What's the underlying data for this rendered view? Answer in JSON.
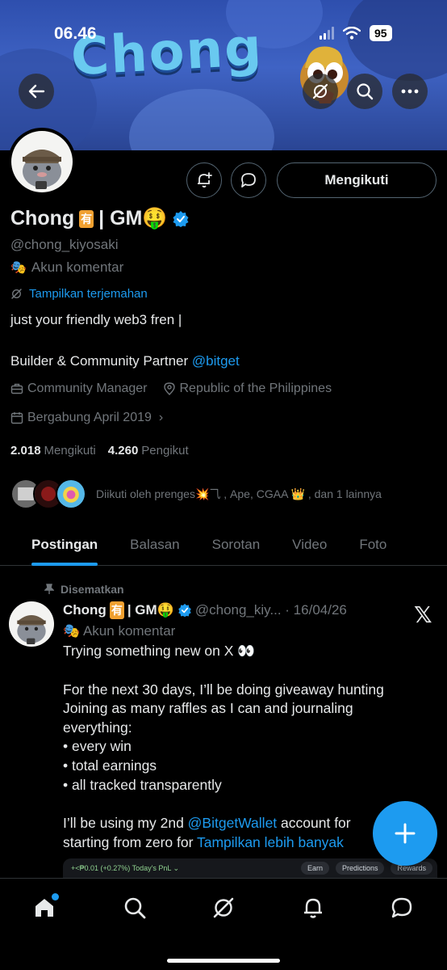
{
  "status_bar": {
    "time": "06.46",
    "battery": "95"
  },
  "banner": {
    "title": "Chong"
  },
  "profile": {
    "follow_label": "Mengikuti",
    "name": "Chong",
    "name_emoji_box": "有",
    "name_suffix": "| GM🤑",
    "handle": "@chong_kiyosaki",
    "account_type": "Akun komentar",
    "translate_label": "Tampilkan terjemahan",
    "bio_line1": "just your friendly web3 fren |",
    "bio_line2_prefix": "Builder & Community Partner ",
    "bio_line2_link": "@bitget",
    "job": "Community Manager",
    "location": "Republic of the Philippines",
    "joined": "Bergabung April 2019",
    "following_count": "2.018",
    "following_label": "Mengikuti",
    "followers_count": "4.260",
    "followers_label": "Pengikut",
    "followed_by_text": "Diikuti oleh prenges💥⺄ , Ape, CGAA 👑 , dan 1 lainnya"
  },
  "tabs": [
    "Postingan",
    "Balasan",
    "Sorotan",
    "Video",
    "Foto"
  ],
  "post": {
    "pinned_label": "Disematkan",
    "name": "Chong",
    "name_emoji_box": "有",
    "name_suffix": "| GM🤑",
    "handle_date": "@chong_kiy... · 16/04/26",
    "account_type": "Akun komentar",
    "line1": "Trying something new on X 👀",
    "line2": "For the next 30 days, I’ll be doing giveaway hunting",
    "line3": "Joining as many raffles as I can and journaling",
    "line4": "everything:",
    "line5": "• every win",
    "line6": "• total earnings",
    "line7": "• all tracked transparently",
    "line8_prefix": "I’ll be using my 2nd ",
    "line8_link": "@BitgetWallet",
    "line8_suffix": " account for",
    "line9_prefix": "starting from zero for ",
    "line9_link": "Tampilkan lebih banyak",
    "media": {
      "pnl": "+<₱0.01 (+0.27%)  Today's PnL ⌄",
      "pill1": "Earn",
      "pill2": "Predictions",
      "pill3": "Rewards"
    }
  },
  "colors": {
    "accent": "#1d9bf0",
    "background": "#000000",
    "muted": "#71767b"
  }
}
